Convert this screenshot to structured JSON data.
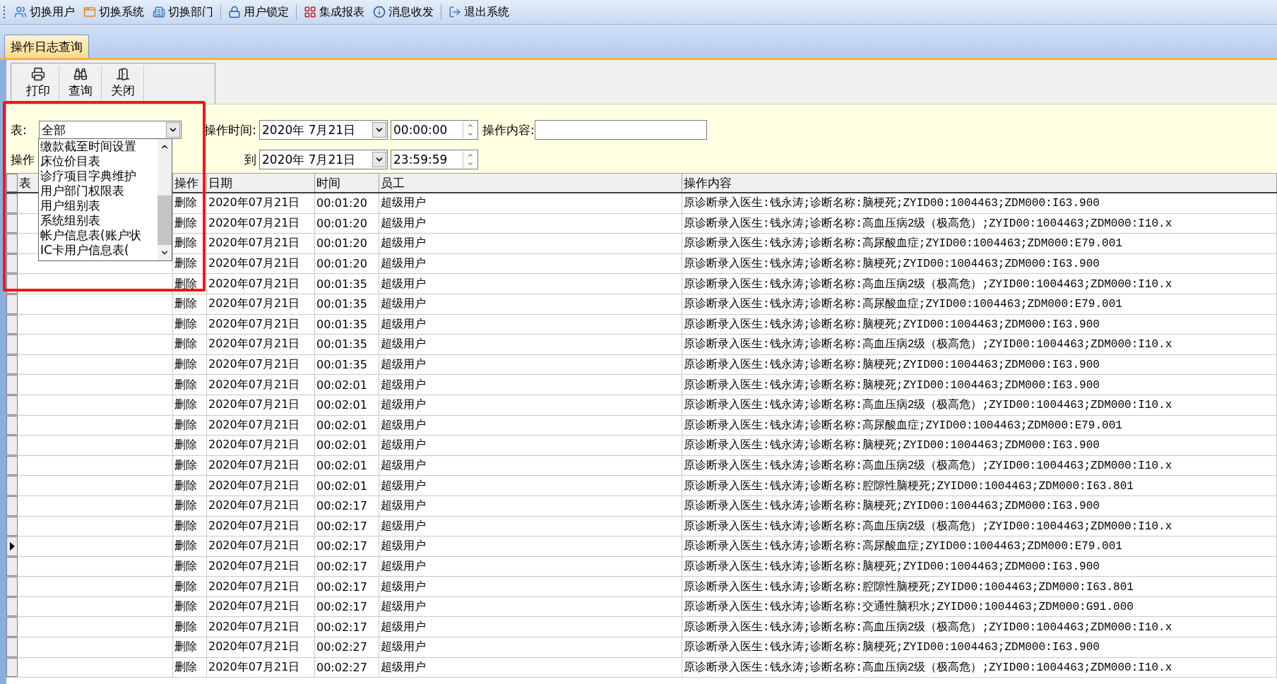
{
  "menu_bar": {
    "groups": [
      {
        "items": [
          "切换用户",
          "切换系统",
          "切换部门"
        ]
      },
      {
        "items": [
          "用户锁定"
        ]
      },
      {
        "items": [
          "集成报表",
          "消息收发"
        ]
      },
      {
        "items": [
          "退出系统"
        ]
      }
    ]
  },
  "tabs": [
    {
      "label": "操作日志查询",
      "selected": true
    }
  ],
  "toolbar": {
    "buttons": [
      "打印",
      "查询",
      "关闭"
    ]
  },
  "filters": {
    "table_label": "表:",
    "table_value": "全部",
    "table_options": [
      "缴款截至时间设置",
      "床位价目表",
      "诊疗项目字典维护",
      "用户部门权限表",
      "用户组别表",
      "系统组别表",
      "帐户信息表(账户状",
      "IC卡用户信息表("
    ],
    "operator_label": "操作",
    "time_label": "操作时间:",
    "from_date": "2020年 7月21日",
    "from_time": "00:00:00",
    "to_label": "到",
    "to_date": "2020年 7月21日",
    "to_time": "23:59:59",
    "content_label": "操作内容:"
  },
  "table": {
    "columns": [
      "表",
      "操作",
      "日期",
      "时间",
      "员工",
      "操作内容"
    ],
    "rows": [
      {
        "operation": "删除",
        "date": "2020年07月21日",
        "time": "00:01:20",
        "staff": "超级用户",
        "content": "原诊断录入医生:钱永涛;诊断名称:脑梗死;ZYID00:1004463;ZDM000:I63.900",
        "selected": false
      },
      {
        "operation": "删除",
        "date": "2020年07月21日",
        "time": "00:01:20",
        "staff": "超级用户",
        "content": "原诊断录入医生:钱永涛;诊断名称:高血压病2级（极高危）;ZYID00:1004463;ZDM000:I10.x",
        "selected": false
      },
      {
        "operation": "删除",
        "date": "2020年07月21日",
        "time": "00:01:20",
        "staff": "超级用户",
        "content": "原诊断录入医生:钱永涛;诊断名称:高尿酸血症;ZYID00:1004463;ZDM000:E79.001",
        "selected": false
      },
      {
        "operation": "删除",
        "date": "2020年07月21日",
        "time": "00:01:20",
        "staff": "超级用户",
        "content": "原诊断录入医生:钱永涛;诊断名称:脑梗死;ZYID00:1004463;ZDM000:I63.900",
        "selected": false
      },
      {
        "operation": "删除",
        "date": "2020年07月21日",
        "time": "00:01:35",
        "staff": "超级用户",
        "content": "原诊断录入医生:钱永涛;诊断名称:高血压病2级（极高危）;ZYID00:1004463;ZDM000:I10.x",
        "selected": false
      },
      {
        "operation": "删除",
        "date": "2020年07月21日",
        "time": "00:01:35",
        "staff": "超级用户",
        "content": "原诊断录入医生:钱永涛;诊断名称:高尿酸血症;ZYID00:1004463;ZDM000:E79.001",
        "selected": false
      },
      {
        "operation": "删除",
        "date": "2020年07月21日",
        "time": "00:01:35",
        "staff": "超级用户",
        "content": "原诊断录入医生:钱永涛;诊断名称:脑梗死;ZYID00:1004463;ZDM000:I63.900",
        "selected": false
      },
      {
        "operation": "删除",
        "date": "2020年07月21日",
        "time": "00:01:35",
        "staff": "超级用户",
        "content": "原诊断录入医生:钱永涛;诊断名称:高血压病2级（极高危）;ZYID00:1004463;ZDM000:I10.x",
        "selected": false
      },
      {
        "operation": "删除",
        "date": "2020年07月21日",
        "time": "00:01:35",
        "staff": "超级用户",
        "content": "原诊断录入医生:钱永涛;诊断名称:脑梗死;ZYID00:1004463;ZDM000:I63.900",
        "selected": false
      },
      {
        "operation": "删除",
        "date": "2020年07月21日",
        "time": "00:02:01",
        "staff": "超级用户",
        "content": "原诊断录入医生:钱永涛;诊断名称:脑梗死;ZYID00:1004463;ZDM000:I63.900",
        "selected": false
      },
      {
        "operation": "删除",
        "date": "2020年07月21日",
        "time": "00:02:01",
        "staff": "超级用户",
        "content": "原诊断录入医生:钱永涛;诊断名称:高血压病2级（极高危）;ZYID00:1004463;ZDM000:I10.x",
        "selected": false
      },
      {
        "operation": "删除",
        "date": "2020年07月21日",
        "time": "00:02:01",
        "staff": "超级用户",
        "content": "原诊断录入医生:钱永涛;诊断名称:高尿酸血症;ZYID00:1004463;ZDM000:E79.001",
        "selected": false
      },
      {
        "operation": "删除",
        "date": "2020年07月21日",
        "time": "00:02:01",
        "staff": "超级用户",
        "content": "原诊断录入医生:钱永涛;诊断名称:脑梗死;ZYID00:1004463;ZDM000:I63.900",
        "selected": false
      },
      {
        "operation": "删除",
        "date": "2020年07月21日",
        "time": "00:02:01",
        "staff": "超级用户",
        "content": "原诊断录入医生:钱永涛;诊断名称:高血压病2级（极高危）;ZYID00:1004463;ZDM000:I10.x",
        "selected": false
      },
      {
        "operation": "删除",
        "date": "2020年07月21日",
        "time": "00:02:01",
        "staff": "超级用户",
        "content": "原诊断录入医生:钱永涛;诊断名称:腔隙性脑梗死;ZYID00:1004463;ZDM000:I63.801",
        "selected": false
      },
      {
        "operation": "删除",
        "date": "2020年07月21日",
        "time": "00:02:17",
        "staff": "超级用户",
        "content": "原诊断录入医生:钱永涛;诊断名称:脑梗死;ZYID00:1004463;ZDM000:I63.900",
        "selected": false
      },
      {
        "operation": "删除",
        "date": "2020年07月21日",
        "time": "00:02:17",
        "staff": "超级用户",
        "content": "原诊断录入医生:钱永涛;诊断名称:高血压病2级（极高危）;ZYID00:1004463;ZDM000:I10.x",
        "selected": false
      },
      {
        "operation": "删除",
        "date": "2020年07月21日",
        "time": "00:02:17",
        "staff": "超级用户",
        "content": "原诊断录入医生:钱永涛;诊断名称:高尿酸血症;ZYID00:1004463;ZDM000:E79.001",
        "selected": true
      },
      {
        "operation": "删除",
        "date": "2020年07月21日",
        "time": "00:02:17",
        "staff": "超级用户",
        "content": "原诊断录入医生:钱永涛;诊断名称:脑梗死;ZYID00:1004463;ZDM000:I63.900",
        "selected": false
      },
      {
        "operation": "删除",
        "date": "2020年07月21日",
        "time": "00:02:17",
        "staff": "超级用户",
        "content": "原诊断录入医生:钱永涛;诊断名称:腔隙性脑梗死;ZYID00:1004463;ZDM000:I63.801",
        "selected": false
      },
      {
        "operation": "删除",
        "date": "2020年07月21日",
        "time": "00:02:17",
        "staff": "超级用户",
        "content": "原诊断录入医生:钱永涛;诊断名称:交通性脑积水;ZYID00:1004463;ZDM000:G91.000",
        "selected": false
      },
      {
        "operation": "删除",
        "date": "2020年07月21日",
        "time": "00:02:17",
        "staff": "超级用户",
        "content": "原诊断录入医生:钱永涛;诊断名称:高血压病2级（极高危）;ZYID00:1004463;ZDM000:I10.x",
        "selected": false
      },
      {
        "operation": "删除",
        "date": "2020年07月21日",
        "time": "00:02:27",
        "staff": "超级用户",
        "content": "原诊断录入医生:钱永涛;诊断名称:脑梗死;ZYID00:1004463;ZDM000:I63.900",
        "selected": false
      },
      {
        "operation": "删除",
        "date": "2020年07月21日",
        "time": "00:02:27",
        "staff": "超级用户",
        "content": "原诊断录入医生:钱永涛;诊断名称:高血压病2级（极高危）;ZYID00:1004463;ZDM000:I10.x",
        "selected": false
      }
    ]
  },
  "annotation": {
    "kind": "highlight-box"
  }
}
